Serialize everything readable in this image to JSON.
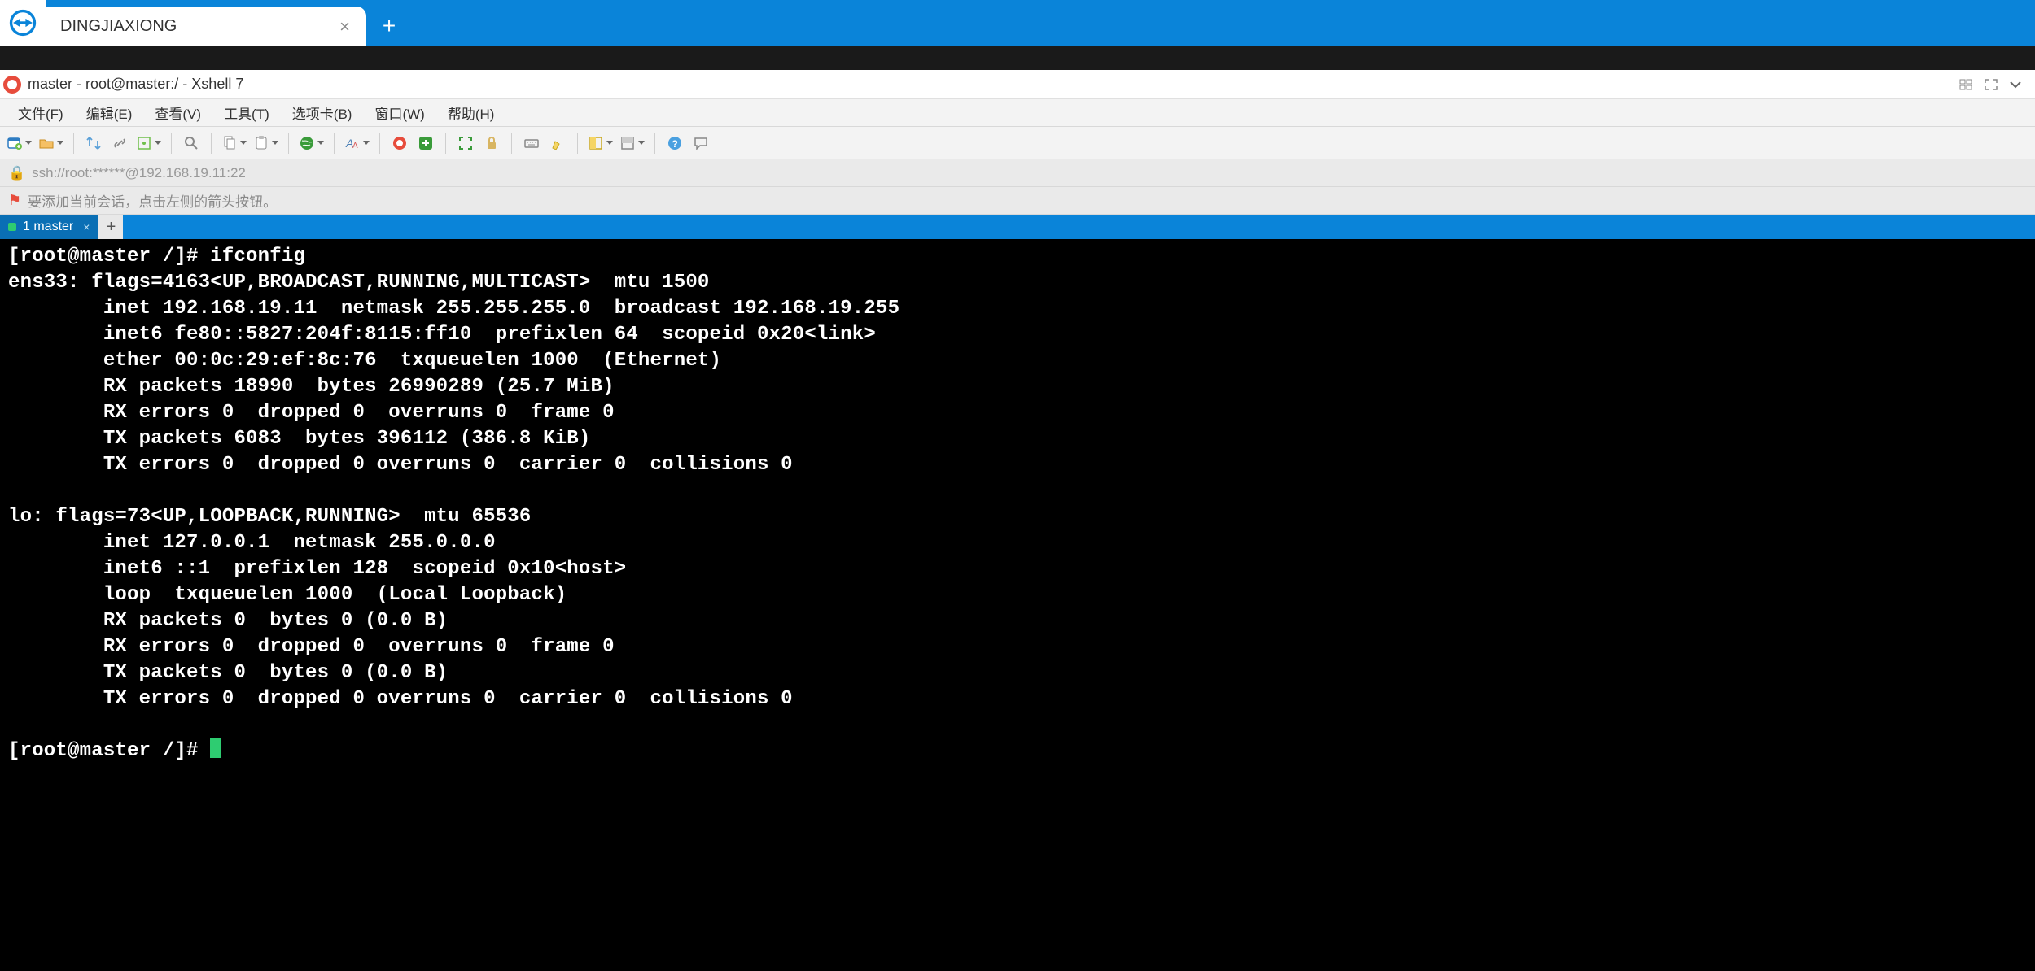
{
  "tv": {
    "tab_title": "DINGJIAXIONG"
  },
  "xshell": {
    "title": "master - root@master:/ - Xshell 7",
    "menu": [
      "文件(F)",
      "编辑(E)",
      "查看(V)",
      "工具(T)",
      "选项卡(B)",
      "窗口(W)",
      "帮助(H)"
    ],
    "address": "ssh://root:******@192.168.19.11:22",
    "hint": "要添加当前会话，点击左侧的箭头按钮。",
    "session_tab": "1 master"
  },
  "terminal": {
    "lines": [
      "[root@master /]# ifconfig",
      "ens33: flags=4163<UP,BROADCAST,RUNNING,MULTICAST>  mtu 1500",
      "        inet 192.168.19.11  netmask 255.255.255.0  broadcast 192.168.19.255",
      "        inet6 fe80::5827:204f:8115:ff10  prefixlen 64  scopeid 0x20<link>",
      "        ether 00:0c:29:ef:8c:76  txqueuelen 1000  (Ethernet)",
      "        RX packets 18990  bytes 26990289 (25.7 MiB)",
      "        RX errors 0  dropped 0  overruns 0  frame 0",
      "        TX packets 6083  bytes 396112 (386.8 KiB)",
      "        TX errors 0  dropped 0 overruns 0  carrier 0  collisions 0",
      "",
      "lo: flags=73<UP,LOOPBACK,RUNNING>  mtu 65536",
      "        inet 127.0.0.1  netmask 255.0.0.0",
      "        inet6 ::1  prefixlen 128  scopeid 0x10<host>",
      "        loop  txqueuelen 1000  (Local Loopback)",
      "        RX packets 0  bytes 0 (0.0 B)",
      "        RX errors 0  dropped 0  overruns 0  frame 0",
      "        TX packets 0  bytes 0 (0.0 B)",
      "        TX errors 0  dropped 0 overruns 0  carrier 0  collisions 0",
      ""
    ],
    "prompt": "[root@master /]# "
  }
}
